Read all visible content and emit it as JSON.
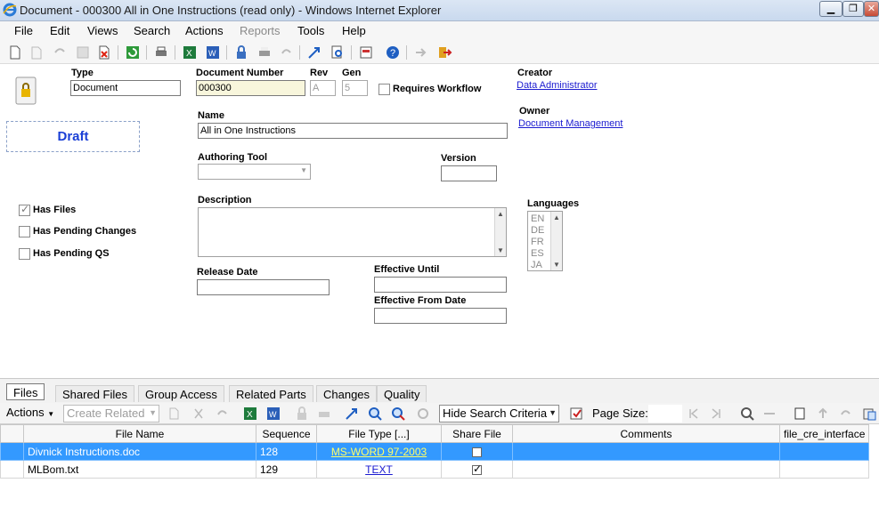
{
  "window": {
    "title": "Document - 000300 All in One Instructions (read only) - Windows Internet Explorer"
  },
  "menu": [
    {
      "label": "File",
      "enabled": true
    },
    {
      "label": "Edit",
      "enabled": true
    },
    {
      "label": "Views",
      "enabled": true
    },
    {
      "label": "Search",
      "enabled": true
    },
    {
      "label": "Actions",
      "enabled": true
    },
    {
      "label": "Reports",
      "enabled": false
    },
    {
      "label": "Tools",
      "enabled": true
    },
    {
      "label": "Help",
      "enabled": true
    }
  ],
  "toolbar_icons": [
    "new-icon",
    "open-icon",
    "undo-icon",
    "save-icon",
    "delete-icon",
    "refresh-icon",
    "print-icon",
    "excel-icon",
    "word-icon",
    "lock-icon",
    "print-preview-icon",
    "undo-arrow-icon",
    "promote-icon",
    "search-doc-icon",
    "report-icon",
    "help-icon",
    "export-icon",
    "exit-icon"
  ],
  "form": {
    "type_label": "Type",
    "type_value": "Document",
    "docnum_label": "Document Number",
    "docnum_value": "000300",
    "rev_label": "Rev",
    "rev_value": "A",
    "gen_label": "Gen",
    "gen_value": "5",
    "requires_workflow_label": "Requires Workflow",
    "creator_label": "Creator",
    "creator_value": "Data Administrator",
    "owner_label": "Owner",
    "owner_value": "Document Management",
    "state": "Draft",
    "name_label": "Name",
    "name_value": "All in One Instructions",
    "authoring_tool_label": "Authoring Tool",
    "authoring_tool_value": "",
    "version_label": "Version",
    "version_value": "",
    "description_label": "Description",
    "description_value": "",
    "languages_label": "Languages",
    "languages": [
      "EN",
      "DE",
      "FR",
      "ES",
      "JA"
    ],
    "release_date_label": "Release Date",
    "release_date_value": "",
    "effective_until_label": "Effective Until",
    "effective_until_value": "",
    "effective_from_label": "Effective From Date",
    "effective_from_value": "",
    "has_files_label": "Has Files",
    "has_files": true,
    "has_pending_changes_label": "Has Pending Changes",
    "has_pending_changes": false,
    "has_pending_qs_label": "Has Pending QS",
    "has_pending_qs": false
  },
  "tabs": [
    "Files",
    "Shared Files",
    "Group Access",
    "Related Parts",
    "Changes",
    "Quality"
  ],
  "active_tab": "Files",
  "gridbar": {
    "actions_label": "Actions",
    "create_related_label": "Create Related",
    "hide_search_label": "Hide Search Criteria",
    "page_size_label": "Page Size:"
  },
  "grid": {
    "columns": [
      "File Name",
      "Sequence",
      "File Type [...]",
      "Share File",
      "Comments",
      "file_cre_interface"
    ],
    "rows": [
      {
        "file_name": "Divnick Instructions.doc",
        "sequence": "128",
        "file_type": "MS-WORD 97-2003",
        "share_file": false,
        "comments": "",
        "iface": "",
        "selected": true
      },
      {
        "file_name": "MLBom.txt",
        "sequence": "129",
        "file_type": "TEXT",
        "share_file": true,
        "comments": "",
        "iface": "",
        "selected": false
      }
    ]
  },
  "colors": {
    "accent": "#3399ff",
    "link": "#1b1bd0",
    "draft": "#1a3fd6"
  }
}
